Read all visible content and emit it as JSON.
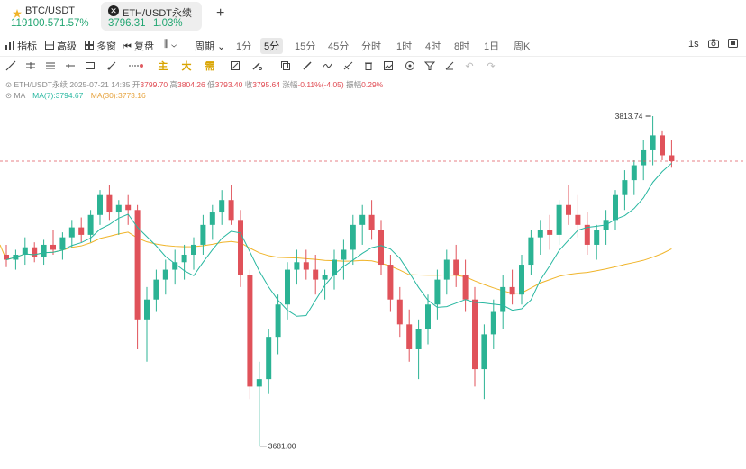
{
  "tabs": [
    {
      "symbol": "BTC/USDT",
      "price": "119100.57",
      "change": "1.57%"
    },
    {
      "symbol": "ETH/USDT永续",
      "price": "3796.31",
      "change": "1.03%"
    }
  ],
  "add_tab_glyph": "+",
  "toolbar": {
    "indicator": "指标",
    "advanced": "高级",
    "multi": "多窗",
    "replay": "复盘",
    "period": "周期",
    "intervals": [
      "1分",
      "5分",
      "15分",
      "45分",
      "分时",
      "1时",
      "4时",
      "8时",
      "1日",
      "周K"
    ],
    "selected_interval": "5分",
    "refresh": "1s"
  },
  "draw_tools": {
    "main": "主",
    "big": "大",
    "secondary": "需"
  },
  "ohlc": {
    "symbol": "ETH/USDT永续",
    "time": "2025-07-21 14:35",
    "open_label": "开",
    "open": "3799.70",
    "high_label": "高",
    "high": "3804.26",
    "low_label": "低",
    "low": "3793.40",
    "close_label": "收",
    "close": "3795.64",
    "chg_label": "涨幅",
    "chg": "-0.11%(-4.05)",
    "amp_label": "振幅",
    "amp": "0.29%"
  },
  "ma": {
    "label": "MA",
    "ma7": "MA(7):3794.67",
    "ma30": "MA(30):3773.16"
  },
  "chart_data": {
    "type": "candlestick",
    "high_label": "3813.74",
    "low_label": "3681.00",
    "high_value": 3813.74,
    "low_value": 3681.0,
    "colors": {
      "up": "#2bb394",
      "down": "#e0525a",
      "ma7": "#27b7a0",
      "ma30": "#f0b429",
      "current": "#e05a60"
    },
    "candles": [
      [
        3758,
        3762,
        3753,
        3756
      ],
      [
        3756,
        3760,
        3752,
        3758
      ],
      [
        3758,
        3765,
        3754,
        3761
      ],
      [
        3761,
        3763,
        3755,
        3757
      ],
      [
        3757,
        3764,
        3754,
        3762
      ],
      [
        3762,
        3768,
        3758,
        3760
      ],
      [
        3760,
        3767,
        3756,
        3765
      ],
      [
        3765,
        3772,
        3761,
        3769
      ],
      [
        3769,
        3773,
        3763,
        3766
      ],
      [
        3766,
        3776,
        3763,
        3774
      ],
      [
        3774,
        3784,
        3770,
        3782
      ],
      [
        3782,
        3786,
        3772,
        3775
      ],
      [
        3775,
        3780,
        3766,
        3778
      ],
      [
        3778,
        3782,
        3770,
        3776
      ],
      [
        3776,
        3778,
        3720,
        3732
      ],
      [
        3732,
        3745,
        3715,
        3740
      ],
      [
        3740,
        3752,
        3735,
        3748
      ],
      [
        3748,
        3756,
        3742,
        3752
      ],
      [
        3752,
        3760,
        3746,
        3755
      ],
      [
        3755,
        3762,
        3748,
        3758
      ],
      [
        3758,
        3765,
        3752,
        3762
      ],
      [
        3762,
        3774,
        3758,
        3770
      ],
      [
        3770,
        3778,
        3764,
        3775
      ],
      [
        3775,
        3784,
        3770,
        3780
      ],
      [
        3780,
        3786,
        3770,
        3772
      ],
      [
        3772,
        3776,
        3745,
        3750
      ],
      [
        3750,
        3752,
        3700,
        3705
      ],
      [
        3705,
        3715,
        3681,
        3708
      ],
      [
        3708,
        3728,
        3702,
        3725
      ],
      [
        3725,
        3742,
        3718,
        3738
      ],
      [
        3738,
        3755,
        3732,
        3752
      ],
      [
        3752,
        3760,
        3746,
        3755
      ],
      [
        3755,
        3760,
        3748,
        3752
      ],
      [
        3752,
        3758,
        3742,
        3748
      ],
      [
        3748,
        3752,
        3740,
        3750
      ],
      [
        3750,
        3760,
        3744,
        3756
      ],
      [
        3756,
        3764,
        3748,
        3760
      ],
      [
        3760,
        3774,
        3754,
        3770
      ],
      [
        3770,
        3778,
        3762,
        3774
      ],
      [
        3774,
        3780,
        3764,
        3768
      ],
      [
        3768,
        3772,
        3750,
        3754
      ],
      [
        3754,
        3758,
        3735,
        3740
      ],
      [
        3740,
        3745,
        3725,
        3730
      ],
      [
        3730,
        3736,
        3715,
        3720
      ],
      [
        3720,
        3732,
        3708,
        3728
      ],
      [
        3728,
        3742,
        3722,
        3738
      ],
      [
        3738,
        3752,
        3732,
        3748
      ],
      [
        3748,
        3760,
        3742,
        3756
      ],
      [
        3756,
        3762,
        3745,
        3750
      ],
      [
        3750,
        3756,
        3735,
        3740
      ],
      [
        3740,
        3745,
        3705,
        3712
      ],
      [
        3712,
        3730,
        3700,
        3726
      ],
      [
        3726,
        3740,
        3720,
        3735
      ],
      [
        3735,
        3750,
        3728,
        3745
      ],
      [
        3745,
        3752,
        3738,
        3742
      ],
      [
        3742,
        3758,
        3738,
        3754
      ],
      [
        3754,
        3768,
        3750,
        3765
      ],
      [
        3765,
        3772,
        3758,
        3768
      ],
      [
        3768,
        3774,
        3760,
        3766
      ],
      [
        3766,
        3780,
        3762,
        3778
      ],
      [
        3778,
        3786,
        3770,
        3774
      ],
      [
        3774,
        3782,
        3765,
        3770
      ],
      [
        3770,
        3775,
        3758,
        3762
      ],
      [
        3762,
        3770,
        3756,
        3768
      ],
      [
        3768,
        3776,
        3762,
        3772
      ],
      [
        3772,
        3784,
        3768,
        3782
      ],
      [
        3782,
        3792,
        3776,
        3788
      ],
      [
        3788,
        3796,
        3782,
        3794
      ],
      [
        3794,
        3804,
        3788,
        3800
      ],
      [
        3800,
        3813.74,
        3794,
        3806
      ],
      [
        3806,
        3808,
        3796,
        3798
      ],
      [
        3798,
        3804,
        3793,
        3795.64
      ]
    ]
  }
}
